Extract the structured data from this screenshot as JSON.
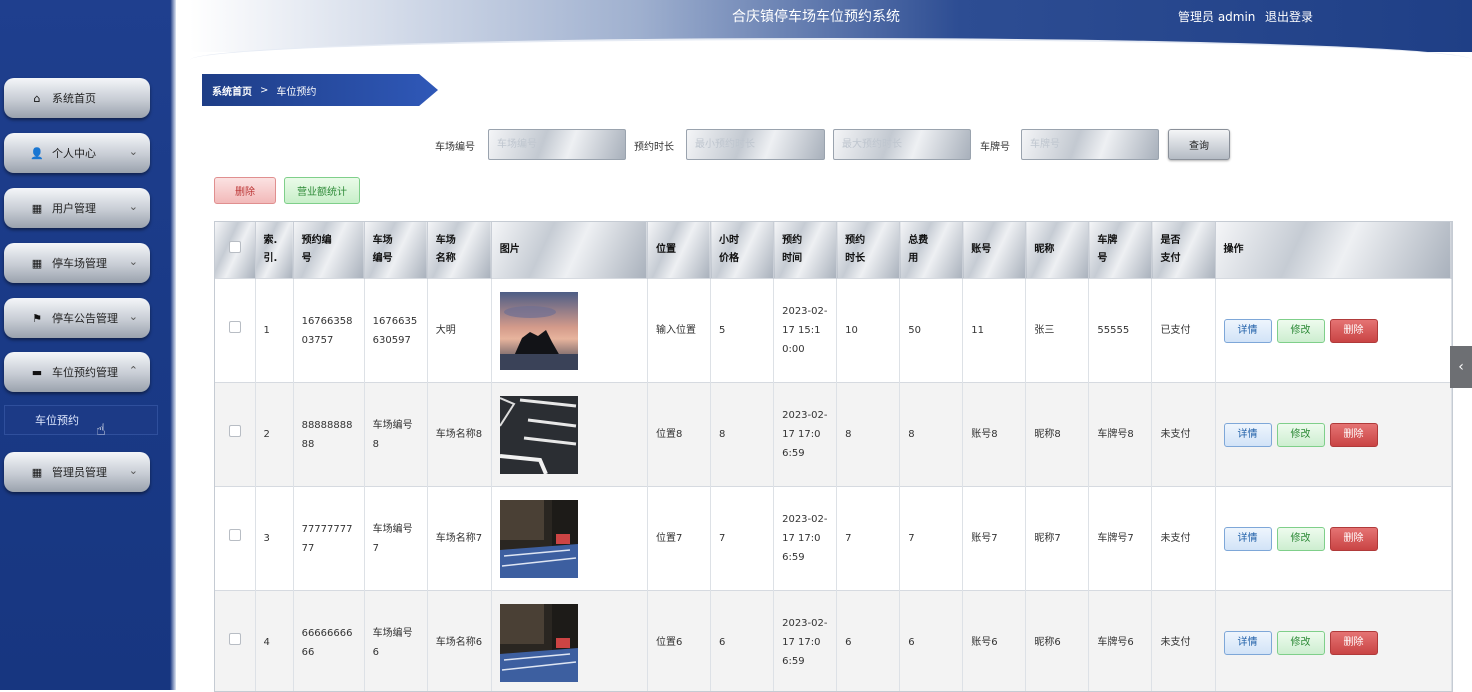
{
  "header": {
    "title": "合庆镇停车场车位预约系统",
    "admin": "管理员 admin",
    "logout": "退出登录"
  },
  "sidebar": {
    "items": [
      {
        "label": "系统首页",
        "icon": "home-icon",
        "glyph": "⌂",
        "chevron": ""
      },
      {
        "label": "个人中心",
        "icon": "user-icon",
        "glyph": "👤",
        "chevron": "⌄"
      },
      {
        "label": "用户管理",
        "icon": "grid-icon",
        "glyph": "▦",
        "chevron": "⌄"
      },
      {
        "label": "停车场管理",
        "icon": "grid-icon",
        "glyph": "▦",
        "chevron": "⌄"
      },
      {
        "label": "停车公告管理",
        "icon": "flag-icon",
        "glyph": "⚑",
        "chevron": "⌄"
      },
      {
        "label": "车位预约管理",
        "icon": "briefcase-icon",
        "glyph": "▬",
        "chevron": "⌃"
      },
      {
        "label": "管理员管理",
        "icon": "grid-icon",
        "glyph": "▦",
        "chevron": "⌄"
      }
    ],
    "subitem": "车位预约"
  },
  "breadcrumb": {
    "home": "系统首页",
    "separator": ">",
    "current": "车位预约"
  },
  "search": {
    "lot_label": "车场编号",
    "lot_placeholder": "车场编号",
    "duration_label": "预约时长",
    "min_placeholder": "最小预约时长",
    "max_placeholder": "最大预约时长",
    "plate_label": "车牌号",
    "plate_placeholder": "车牌号",
    "button": "查询"
  },
  "actions": {
    "delete": "删除",
    "stats": "营业额统计"
  },
  "table": {
    "columns": [
      {
        "label": "索.\n引."
      },
      {
        "label": "预约编\n号"
      },
      {
        "label": "车场\n编号"
      },
      {
        "label": "车场\n名称"
      },
      {
        "label": "图片"
      },
      {
        "label": "位置"
      },
      {
        "label": "小时\n价格"
      },
      {
        "label": "预约\n时间"
      },
      {
        "label": "预约\n时长"
      },
      {
        "label": "总费\n用"
      },
      {
        "label": "账号"
      },
      {
        "label": "昵称"
      },
      {
        "label": "车牌\n号"
      },
      {
        "label": "是否\n支付"
      },
      {
        "label": "操作"
      }
    ],
    "op_labels": {
      "detail": "详情",
      "edit": "修改",
      "delete": "删除"
    },
    "rows": [
      {
        "index": "1",
        "booking_no": "1676635803757",
        "lot_no": "1676635630597",
        "lot_name": "大明",
        "image": "sunset-rock",
        "position": "输入位置",
        "price": "5",
        "time": "2023-02-17 15:10:00",
        "duration": "10",
        "total": "50",
        "account": "11",
        "nickname": "张三",
        "plate": "55555",
        "paid": "已支付"
      },
      {
        "index": "2",
        "booking_no": "8888888888",
        "lot_no": "车场编号8",
        "lot_name": "车场名称8",
        "image": "parking-lines",
        "position": "位置8",
        "price": "8",
        "time": "2023-02-17 17:06:59",
        "duration": "8",
        "total": "8",
        "account": "账号8",
        "nickname": "昵称8",
        "plate": "车牌号8",
        "paid": "未支付"
      },
      {
        "index": "3",
        "booking_no": "7777777777",
        "lot_no": "车场编号7",
        "lot_name": "车场名称7",
        "image": "parking-blue",
        "position": "位置7",
        "price": "7",
        "time": "2023-02-17 17:06:59",
        "duration": "7",
        "total": "7",
        "account": "账号7",
        "nickname": "昵称7",
        "plate": "车牌号7",
        "paid": "未支付"
      },
      {
        "index": "4",
        "booking_no": "6666666666",
        "lot_no": "车场编号6",
        "lot_name": "车场名称6",
        "image": "parking-blue",
        "position": "位置6",
        "price": "6",
        "time": "2023-02-17 17:06:59",
        "duration": "6",
        "total": "6",
        "account": "账号6",
        "nickname": "昵称6",
        "plate": "车牌号6",
        "paid": "未支付"
      }
    ]
  },
  "side_handle": "‹"
}
